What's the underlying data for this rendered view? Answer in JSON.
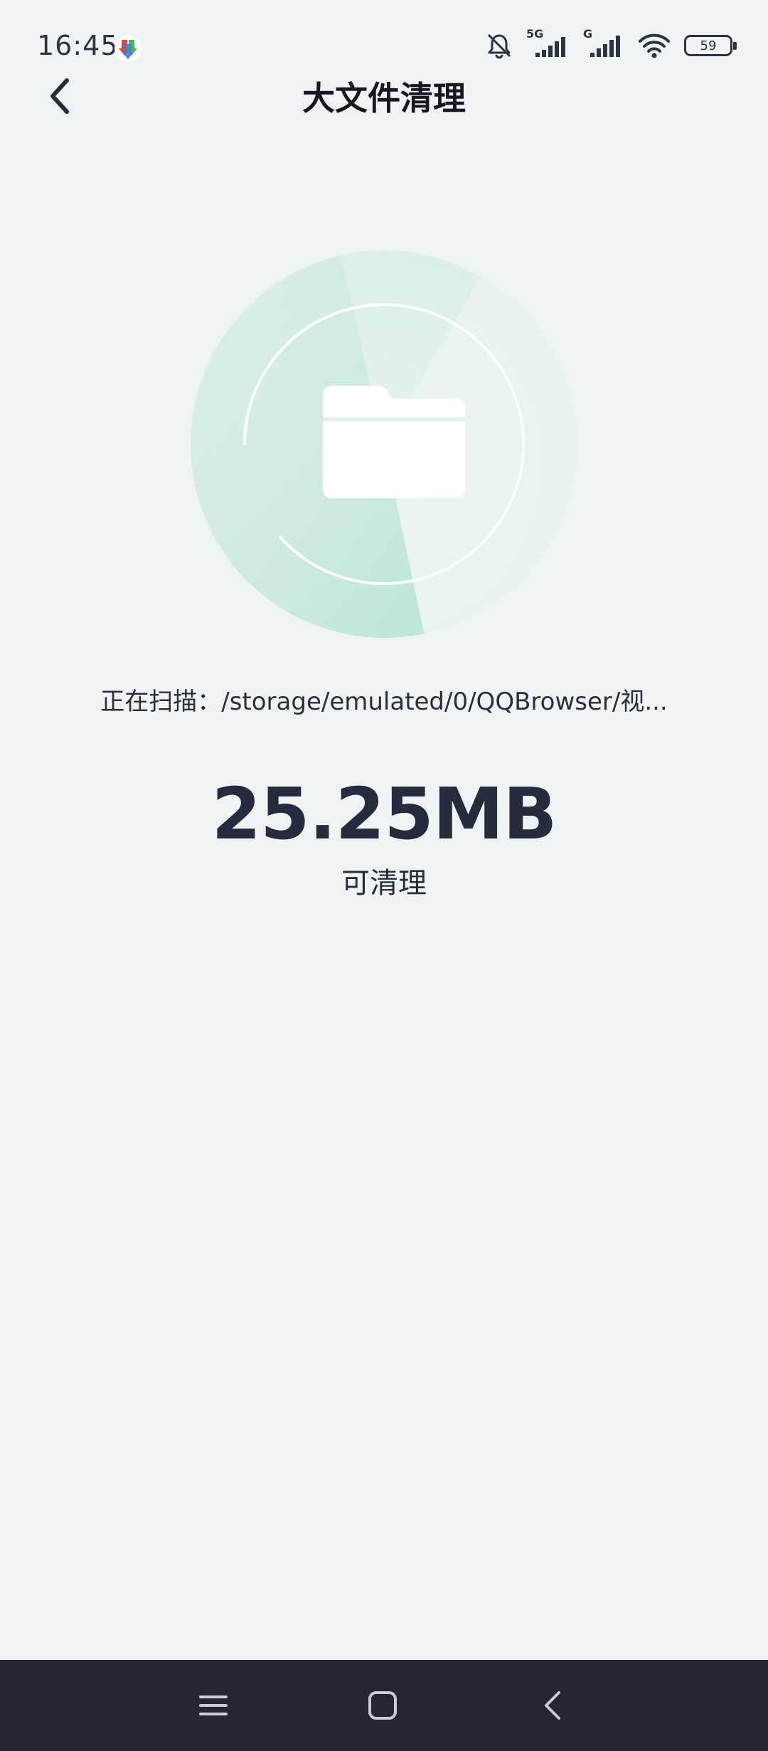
{
  "status_bar": {
    "time": "16:45",
    "battery": "59",
    "network_1": "5G",
    "network_2": "G"
  },
  "header": {
    "title": "大文件清理"
  },
  "scan": {
    "path_text": "正在扫描：/storage/emulated/0/QQBrowser/视...",
    "size": "25.25MB",
    "size_label": "可清理",
    "progress_fraction": 0.45
  },
  "colors": {
    "background": "#edf4f3",
    "accent_mint": "#bfe6d6",
    "text_dark": "#262b3d",
    "nav_bar": "#222733"
  },
  "icons": {
    "back": "chevron-left-icon",
    "folder": "folder-icon",
    "nav_menu": "menu-icon",
    "nav_home": "home-icon",
    "nav_back": "back-icon"
  }
}
